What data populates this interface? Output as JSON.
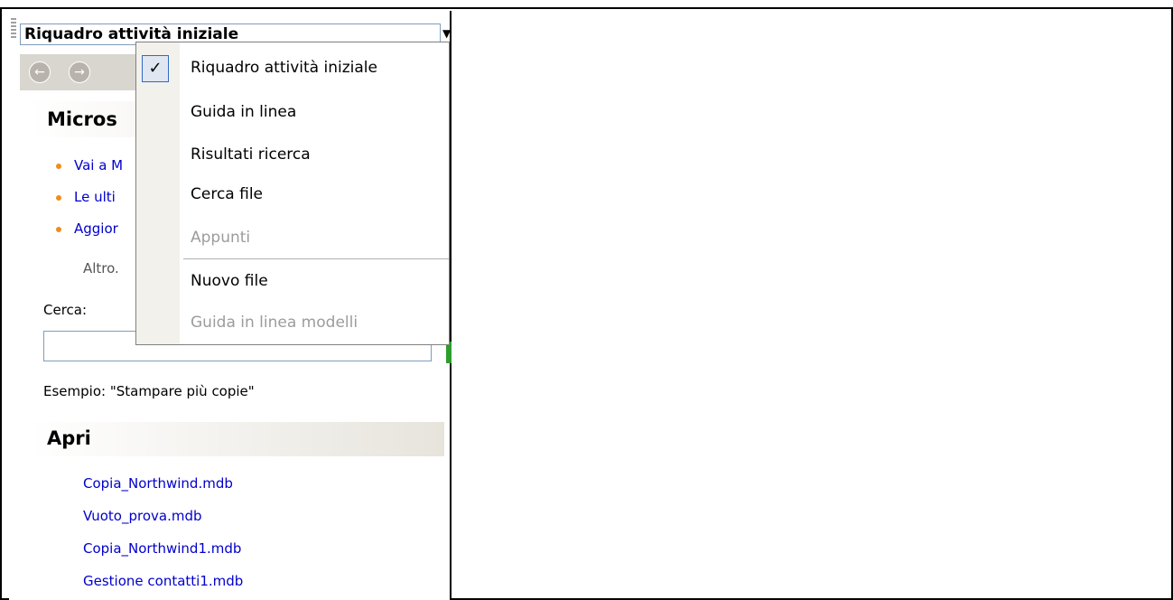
{
  "pane": {
    "selector_label": "Riquadro attività iniziale",
    "nav_back_glyph": "←",
    "nav_forward_glyph": "→",
    "section1_title": "Micros",
    "links": [
      "Vai a M",
      "Le ulti",
      "Aggior"
    ],
    "more_label": "Altro.",
    "search_label": "Cerca:",
    "search_value": "",
    "example_text": "Esempio:  \"Stampare più copie\"",
    "section2_title": "Apri",
    "recent_files": [
      "Copia_Northwind.mdb",
      "Vuoto_prova.mdb",
      "Copia_Northwind1.mdb",
      "Gestione contatti1.mdb"
    ]
  },
  "menu": {
    "check_glyph": "✓",
    "items": [
      {
        "label": "Riquadro attività iniziale",
        "enabled": true,
        "checked": true
      },
      {
        "label": "Guida in linea",
        "enabled": true
      },
      {
        "label": "Risultati ricerca",
        "enabled": true
      },
      {
        "label": "Cerca file",
        "enabled": true
      },
      {
        "label": "Appunti",
        "enabled": false
      },
      {
        "label": "Nuovo file",
        "enabled": true
      },
      {
        "label": "Guida in linea modelli",
        "enabled": false
      }
    ]
  },
  "colors": {
    "link": "#0000cc",
    "bullet": "#f08c1c",
    "disabled": "#9c9c9c",
    "check_border": "#316ac5"
  }
}
